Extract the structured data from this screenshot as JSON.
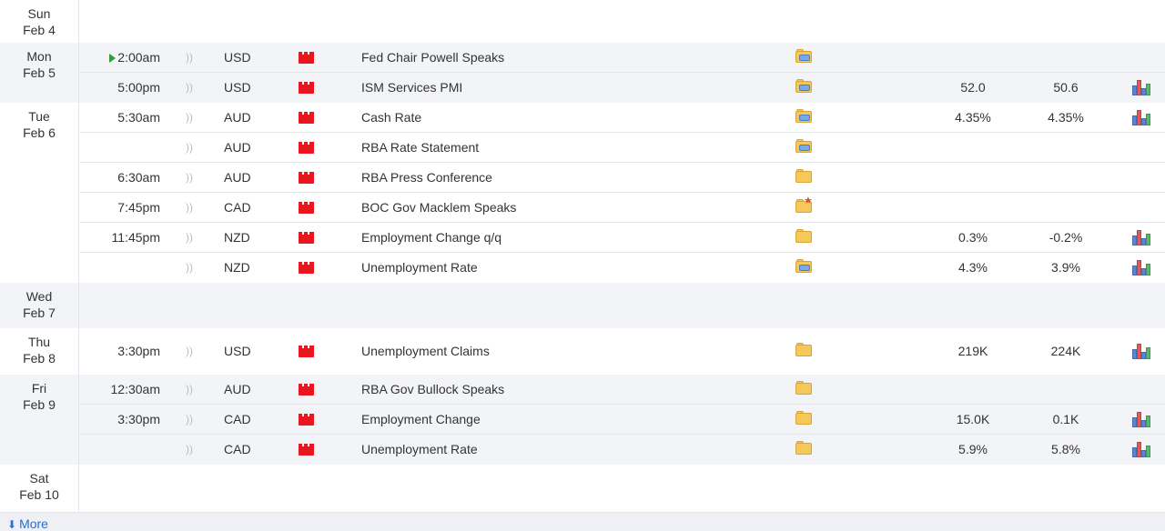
{
  "days": [
    {
      "name": "Sun",
      "date": "Feb 4",
      "events": []
    },
    {
      "name": "Mon",
      "date": "Feb 5",
      "events": [
        {
          "time": "2:00am",
          "current": true,
          "currency": "USD",
          "title": "Fed Chair Powell Speaks",
          "detail": "folder-doc-icon",
          "actual": "",
          "forecast": "",
          "graph": false
        },
        {
          "time": "5:00pm",
          "currency": "USD",
          "title": "ISM Services PMI",
          "detail": "folder-doc-icon",
          "actual": "52.0",
          "forecast": "50.6",
          "graph": true
        }
      ]
    },
    {
      "name": "Tue",
      "date": "Feb 6",
      "events": [
        {
          "time": "5:30am",
          "currency": "AUD",
          "title": "Cash Rate",
          "detail": "folder-doc-icon",
          "actual": "4.35%",
          "forecast": "4.35%",
          "graph": true
        },
        {
          "time": "",
          "currency": "AUD",
          "title": "RBA Rate Statement",
          "detail": "folder-doc-icon",
          "actual": "",
          "forecast": "",
          "graph": false
        },
        {
          "time": "6:30am",
          "currency": "AUD",
          "title": "RBA Press Conference",
          "detail": "folder-icon",
          "actual": "",
          "forecast": "",
          "graph": false
        },
        {
          "time": "7:45pm",
          "currency": "CAD",
          "title": "BOC Gov Macklem Speaks",
          "detail": "folder-star-icon",
          "actual": "",
          "forecast": "",
          "graph": false
        },
        {
          "time": "11:45pm",
          "currency": "NZD",
          "title": "Employment Change q/q",
          "detail": "folder-icon",
          "actual": "0.3%",
          "forecast": "-0.2%",
          "graph": true
        },
        {
          "time": "",
          "currency": "NZD",
          "title": "Unemployment Rate",
          "detail": "folder-doc-icon",
          "actual": "4.3%",
          "forecast": "3.9%",
          "graph": true
        }
      ]
    },
    {
      "name": "Wed",
      "date": "Feb 7",
      "events": []
    },
    {
      "name": "Thu",
      "date": "Feb 8",
      "events": [
        {
          "time": "3:30pm",
          "currency": "USD",
          "title": "Unemployment Claims",
          "detail": "folder-icon",
          "actual": "219K",
          "forecast": "224K",
          "graph": true
        }
      ]
    },
    {
      "name": "Fri",
      "date": "Feb 9",
      "events": [
        {
          "time": "12:30am",
          "currency": "AUD",
          "title": "RBA Gov Bullock Speaks",
          "detail": "folder-icon",
          "actual": "",
          "forecast": "",
          "graph": false
        },
        {
          "time": "3:30pm",
          "currency": "CAD",
          "title": "Employment Change",
          "detail": "folder-icon",
          "actual": "15.0K",
          "forecast": "0.1K",
          "graph": true
        },
        {
          "time": "",
          "currency": "CAD",
          "title": "Unemployment Rate",
          "detail": "folder-icon",
          "actual": "5.9%",
          "forecast": "5.8%",
          "graph": true
        }
      ]
    },
    {
      "name": "Sat",
      "date": "Feb 10",
      "events": []
    }
  ],
  "impact_icon": "sound-wave-icon",
  "impact_glyph": "))",
  "impact_flag_icon": "high-impact-red-folder-icon",
  "graph_icon": "bar-chart-icon",
  "footer": {
    "more_label": "More",
    "more_icon": "download-arrow-icon"
  },
  "colors": {
    "impact_high": "#e8171f",
    "link": "#2a6fc9",
    "now_marker": "#2e9e3c"
  }
}
